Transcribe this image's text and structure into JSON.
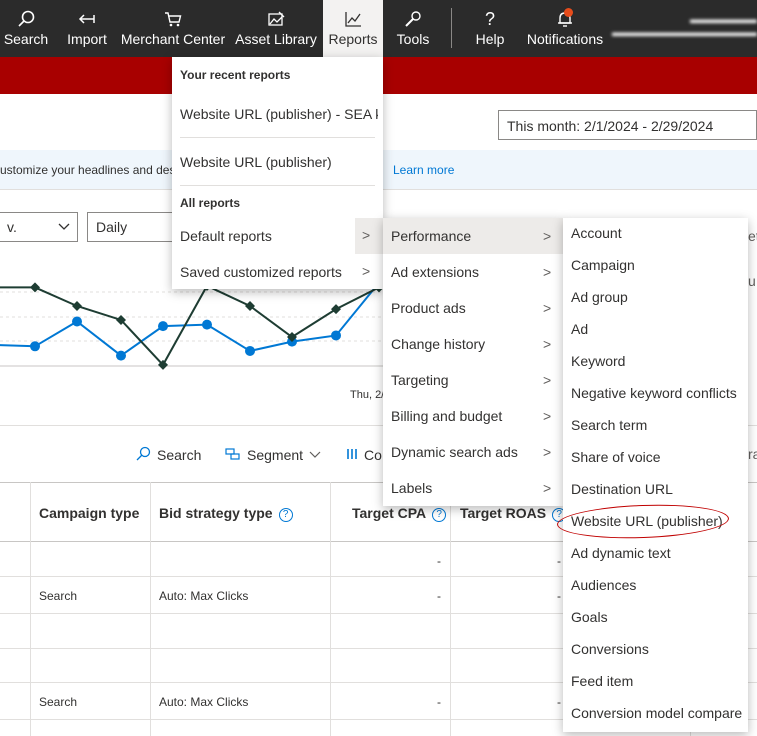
{
  "nav": {
    "items": [
      {
        "label": "Search",
        "icon": "search-icon"
      },
      {
        "label": "Import",
        "icon": "import-arrow-icon"
      },
      {
        "label": "Merchant Center",
        "icon": "shopping-cart-icon"
      },
      {
        "label": "Asset Library",
        "icon": "image-library-icon"
      },
      {
        "label": "Reports",
        "icon": "line-chart-icon"
      },
      {
        "label": "Tools",
        "icon": "wrench-icon"
      },
      {
        "label": "Help",
        "icon": "question-icon"
      },
      {
        "label": "Notifications",
        "icon": "bell-icon"
      }
    ],
    "notification_dot_color": "#e74c1b"
  },
  "date_range": {
    "value": "This month: 2/1/2024 - 2/29/2024"
  },
  "infobar": {
    "text": "ustomize your headlines and des",
    "link": "Learn more"
  },
  "selects": {
    "first": "v.",
    "second": "Daily"
  },
  "chart": {
    "caption": "Thu, 2/"
  },
  "chart_data": {
    "type": "line",
    "series": [
      {
        "color": "#0078d4",
        "marker": "circle",
        "values": [
          15,
          14,
          30,
          8,
          27,
          28,
          11,
          17,
          21,
          55
        ]
      },
      {
        "color": "#1e3d33",
        "marker": "diamond",
        "values": [
          52,
          52,
          40,
          31,
          2,
          53,
          40,
          20,
          38,
          52
        ]
      }
    ]
  },
  "toolbar": {
    "search": "Search",
    "segment": "Segment",
    "columns_partial": "Co",
    "right_partial": "ra"
  },
  "table": {
    "headers": [
      "Campaign type",
      "Bid strategy type",
      "Target CPA",
      "Target ROAS"
    ],
    "rows": [
      {
        "campaign_type": "",
        "bid_strategy": "",
        "target_cpa": "-",
        "target_roas": "-"
      },
      {
        "campaign_type": "Search",
        "bid_strategy": "Auto: Max Clicks",
        "target_cpa": "-",
        "target_roas": "-"
      },
      {
        "campaign_type": "",
        "bid_strategy": "",
        "target_cpa": "",
        "target_roas": ""
      },
      {
        "campaign_type": "",
        "bid_strategy": "",
        "target_cpa": "",
        "target_roas": ""
      },
      {
        "campaign_type": "Search",
        "bid_strategy": "Auto: Max Clicks",
        "target_cpa": "-",
        "target_roas": "-"
      }
    ]
  },
  "reports_menu": {
    "recent_header": "Your recent reports",
    "recent": [
      "Website URL (publisher) - SEA k",
      "Website URL (publisher)"
    ],
    "all_header": "All reports",
    "all": [
      "Default reports",
      "Saved customized reports"
    ]
  },
  "default_reports_menu": {
    "items": [
      "Performance",
      "Ad extensions",
      "Product ads",
      "Change history",
      "Targeting",
      "Billing and budget",
      "Dynamic search ads",
      "Labels"
    ],
    "selected": "Performance"
  },
  "performance_menu": {
    "items": [
      "Account",
      "Campaign",
      "Ad group",
      "Ad",
      "Keyword",
      "Negative keyword conflicts",
      "Search term",
      "Share of voice",
      "Destination URL",
      "Website URL (publisher)",
      "Ad dynamic text",
      "Audiences",
      "Goals",
      "Conversions",
      "Feed item",
      "Conversion model compare"
    ],
    "highlighted": "Website URL (publisher)",
    "highlight_color": "#c00000"
  },
  "edge": {
    "right_top": "et",
    "right_mid": "u"
  }
}
